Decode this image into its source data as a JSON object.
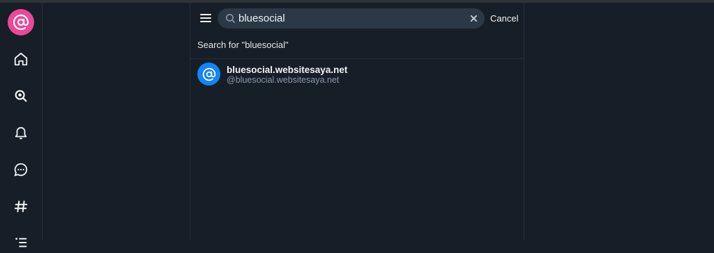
{
  "sidebar": {
    "logo_icon": "at-sign-icon",
    "logo_color": "#ec4899",
    "items": [
      {
        "icon": "home-icon"
      },
      {
        "icon": "search-icon"
      },
      {
        "icon": "bell-icon"
      },
      {
        "icon": "chat-icon"
      },
      {
        "icon": "hashtag-icon"
      },
      {
        "icon": "list-icon"
      }
    ]
  },
  "search": {
    "value": "bluesocial",
    "cancel_label": "Cancel",
    "search_for_label": "Search for \"bluesocial\""
  },
  "results": [
    {
      "display_name": "bluesocial.websitesaya.net",
      "handle": "@bluesocial.websitesaya.net",
      "avatar_color": "#1185fe"
    }
  ],
  "colors": {
    "background": "#161e27",
    "accent": "#1185fe",
    "muted_text": "#8d9aab"
  }
}
